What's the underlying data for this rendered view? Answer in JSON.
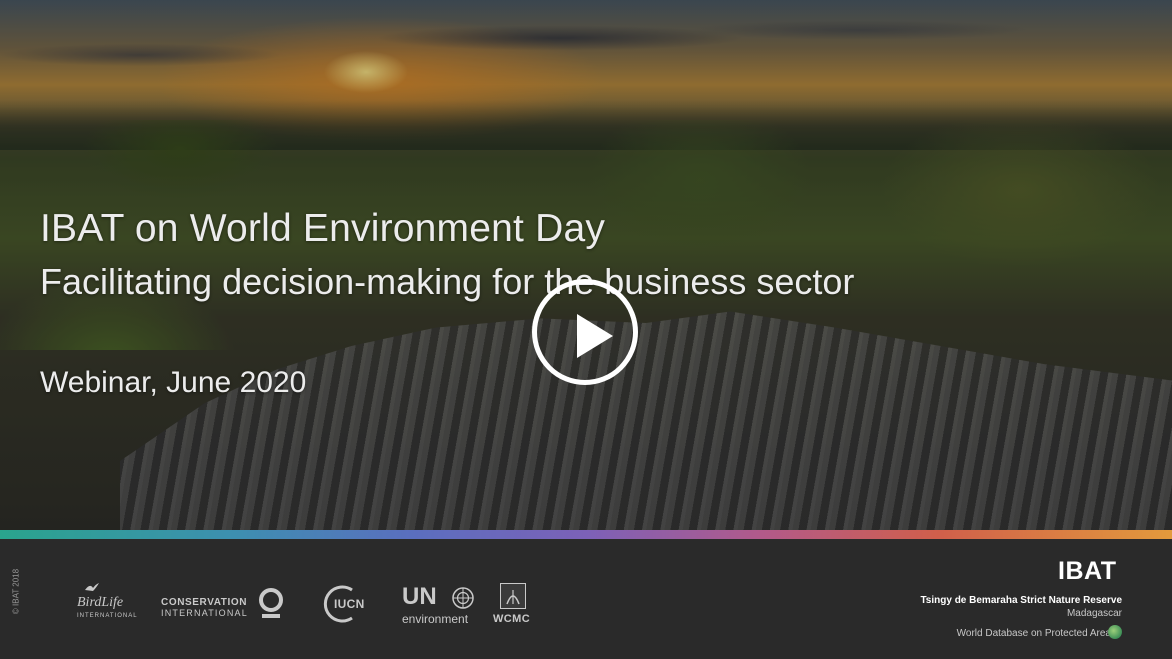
{
  "video": {
    "title_line1": "IBAT on World Environment Day",
    "title_line2": "Facilitating decision-making for the business sector",
    "subtitle": "Webinar, June 2020"
  },
  "footer": {
    "copyright": "© IBAT 2018",
    "partners": {
      "birdlife_name": "BirdLife",
      "birdlife_intl": "INTERNATIONAL",
      "ci_line1": "CONSERVATION",
      "ci_line2": "INTERNATIONAL",
      "iucn": "IUCN",
      "un": "UN",
      "environment": "environment",
      "wcmc": "WCMC"
    },
    "brand": "IBAT",
    "photo_location": "Tsingy de Bemaraha Strict Nature Reserve",
    "photo_country": "Madagascar",
    "database": "World Database on Protected Areas"
  },
  "icons": {
    "play": "play-icon",
    "bird": "bird-icon",
    "ci_mark": "conservation-international-mark-icon",
    "iucn_ring": "iucn-ring-icon",
    "un_emblem": "un-emblem-icon",
    "wcmc_mark": "wcmc-mark-icon",
    "globe": "globe-icon"
  },
  "colors": {
    "footer_bg": "#2a2a2a",
    "title_text": "#ececec",
    "spectrum_start": "#2aa48d",
    "spectrum_end": "#e39a3c"
  }
}
